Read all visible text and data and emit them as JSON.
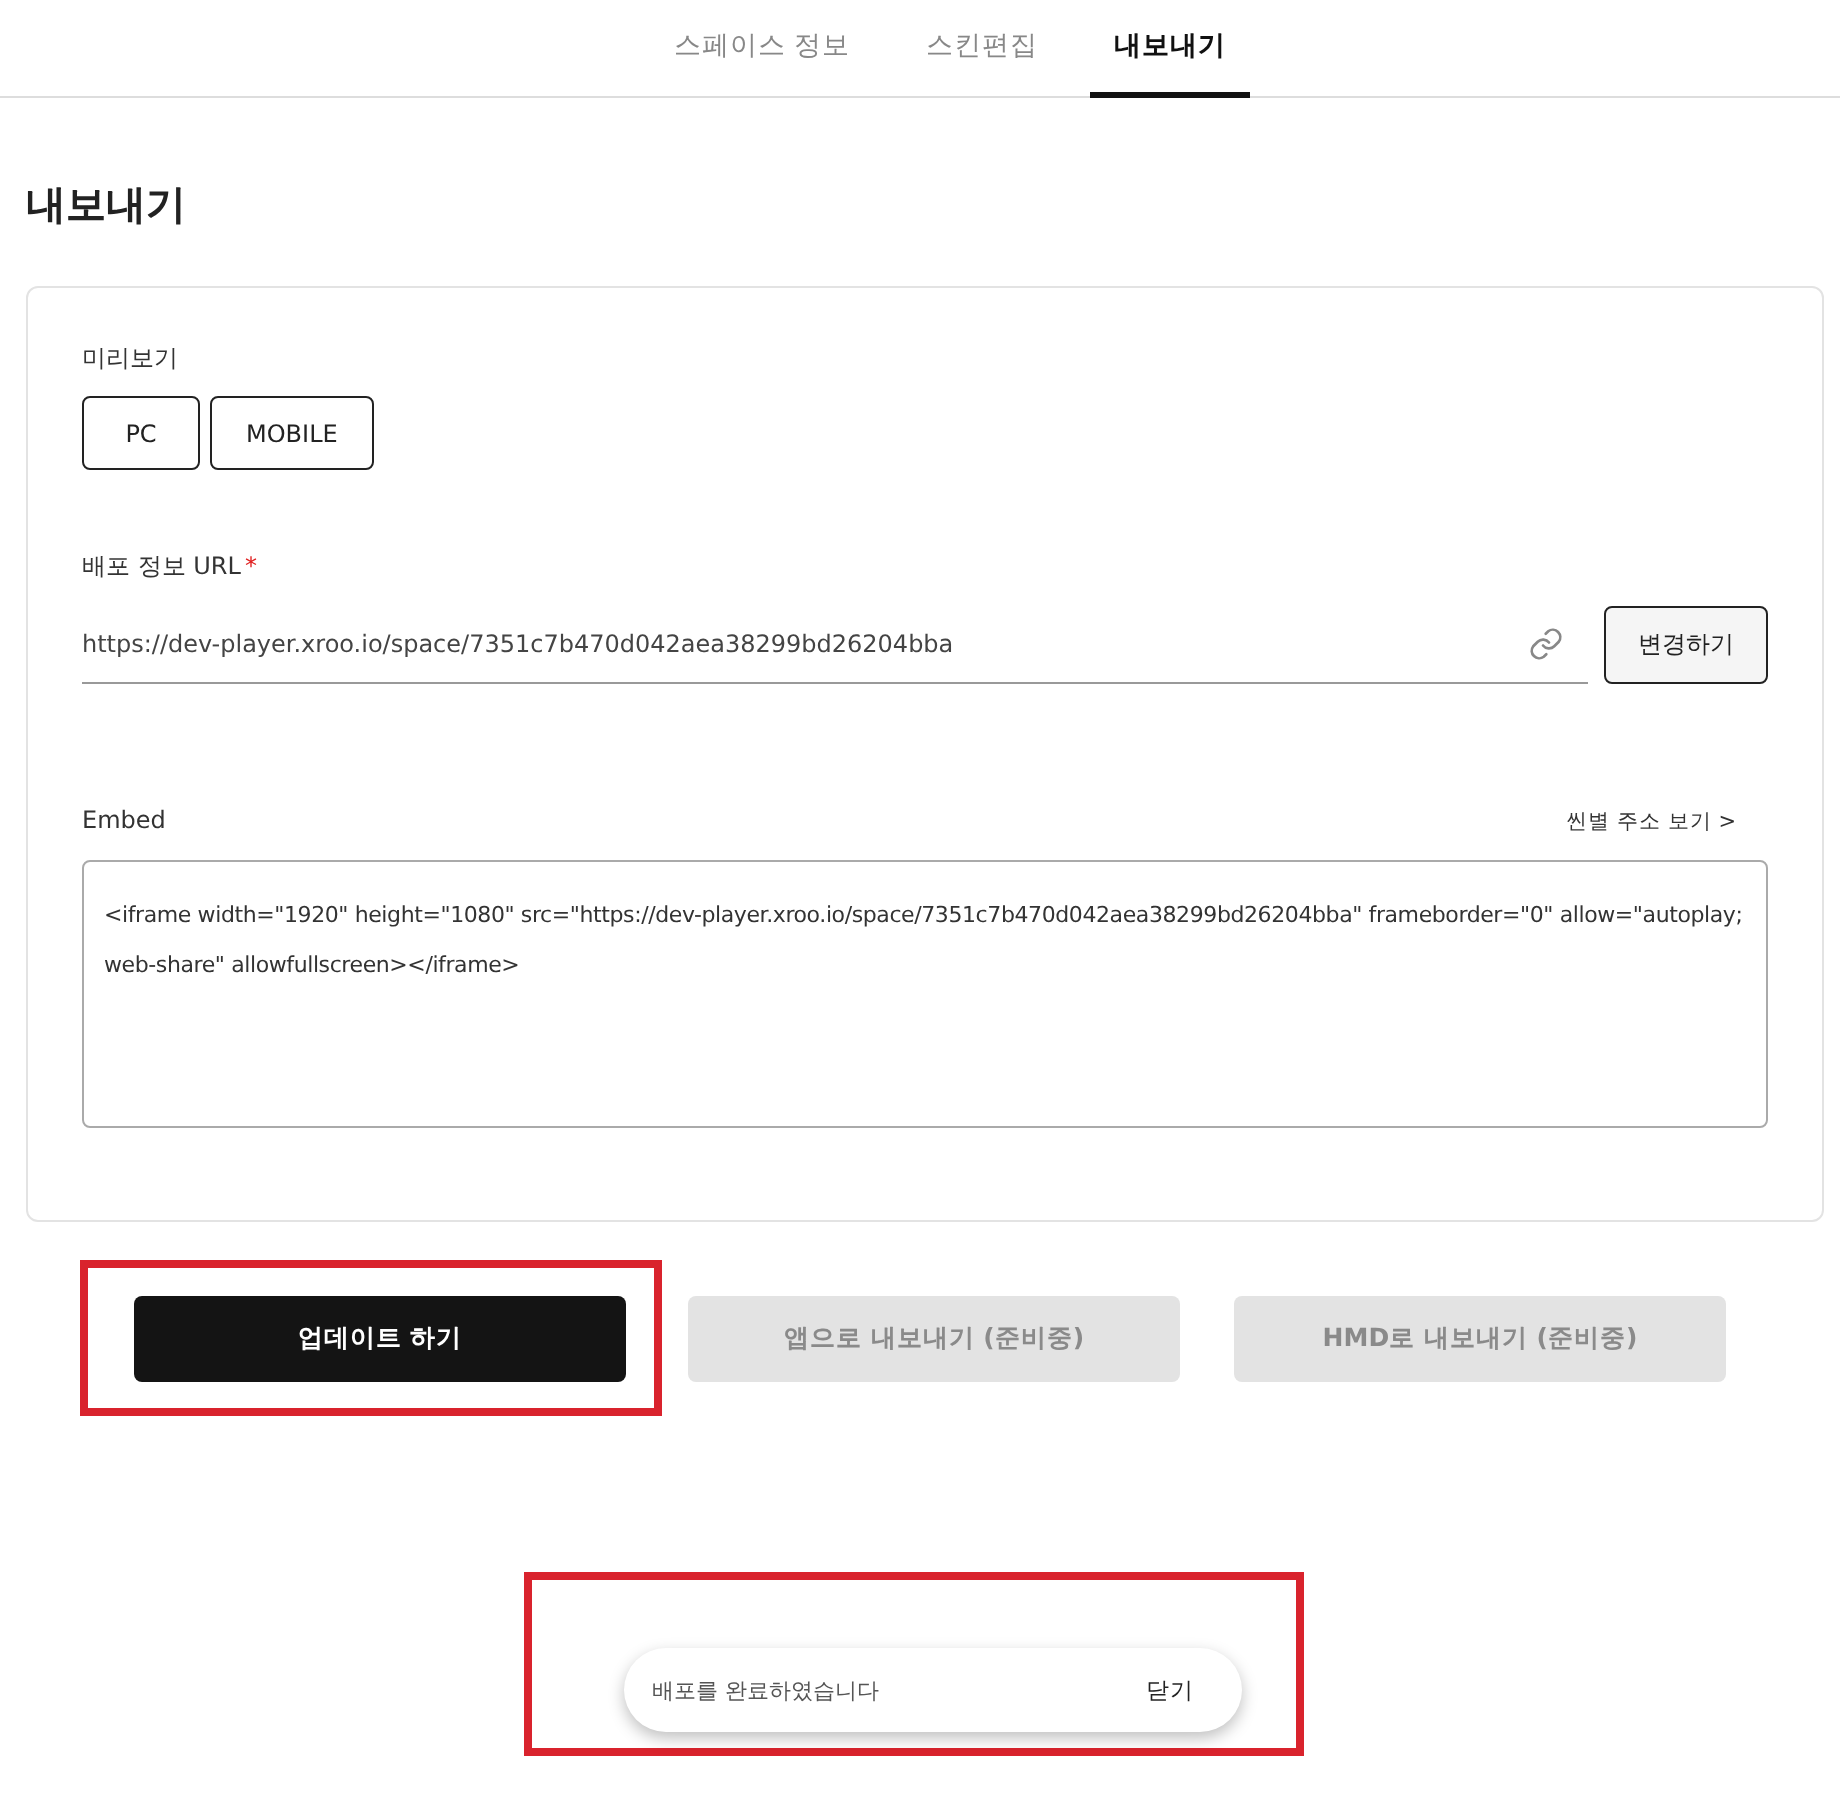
{
  "tabs": [
    {
      "label": "스페이스 정보",
      "selected": false
    },
    {
      "label": "스킨편집",
      "selected": false
    },
    {
      "label": "내보내기",
      "selected": true
    }
  ],
  "heading": "내보내기",
  "preview": {
    "label": "미리보기",
    "buttons": [
      "PC",
      "MOBILE"
    ]
  },
  "url_field": {
    "label": "배포 정보 URL",
    "required_mark": "*",
    "value": "https://dev-player.xroo.io/space/7351c7b470d042aea38299bd26204bba",
    "button": "변경하기"
  },
  "embed": {
    "label": "Embed",
    "link": "씬별 주소 보기 >",
    "lines": [
      "<iframe width=\"1920\" height=\"1080\" src=\"https://dev-player.xroo.io/space/7351c7b470d042aea38299bd26204bba\" frameborder=\"0\" allow=\"autoplay;",
      "web-share\" allowfullscreen></iframe>"
    ]
  },
  "actions": [
    {
      "label": "업데이트 하기",
      "disabled": false,
      "highlighted": true
    },
    {
      "label": "앱으로 내보내기 (준비중)",
      "disabled": true,
      "highlighted": false
    },
    {
      "label": "HMD로 내보내기 (준비중)",
      "disabled": true,
      "highlighted": false
    }
  ],
  "toast": {
    "message": "배포를 완료하였습니다",
    "close": "닫기",
    "highlighted": true
  }
}
